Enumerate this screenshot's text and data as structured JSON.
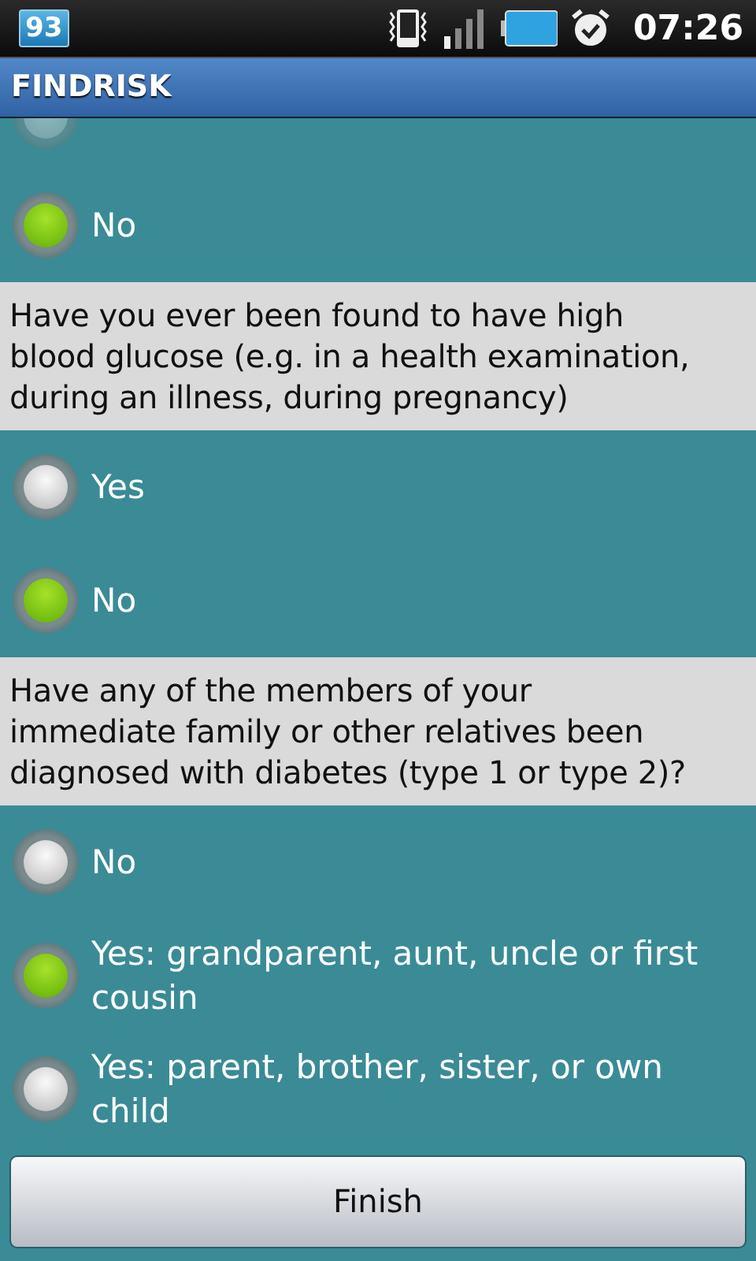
{
  "status_bar": {
    "notification_count": "93",
    "time": "07:26"
  },
  "title": "FINDRISK",
  "groups": [
    {
      "options": [
        {
          "selected": false,
          "cut": true
        },
        {
          "label": "No",
          "selected": true
        }
      ]
    },
    {
      "question": "Have you ever been found to have high blood glucose (e.g. in a health examination, during an illness, during pregnancy)",
      "options": [
        {
          "label": "Yes",
          "selected": false
        },
        {
          "label": "No",
          "selected": true
        }
      ]
    },
    {
      "question": "Have any of the members of your immediate family or other relatives been diagnosed with diabetes (type 1 or type 2)?",
      "options": [
        {
          "label": "No",
          "selected": false
        },
        {
          "label": "Yes: grandparent, aunt, uncle or first cousin",
          "selected": true
        },
        {
          "label": "Yes: parent, brother, sister, or own child",
          "selected": false
        }
      ]
    }
  ],
  "finish_button": "Finish"
}
